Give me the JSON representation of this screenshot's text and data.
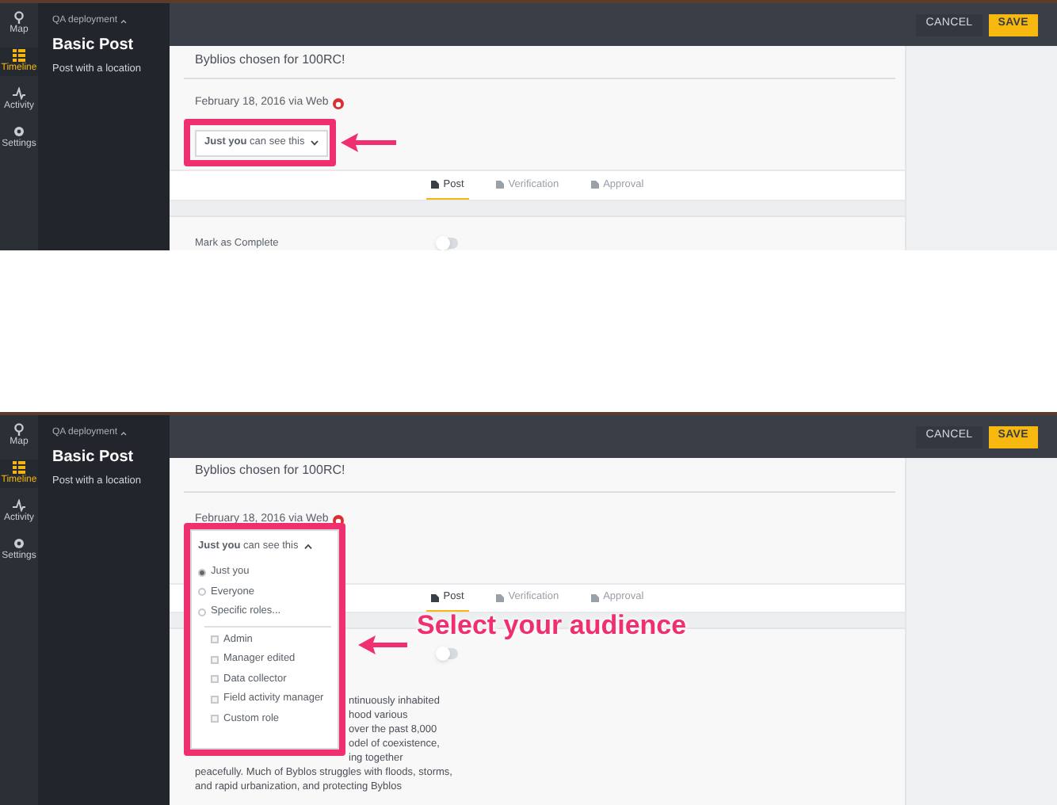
{
  "panels": [
    {
      "nav": [
        {
          "label": "Map",
          "selected": false
        },
        {
          "label": "Timeline",
          "selected": true
        },
        {
          "label": "Activity",
          "selected": false
        },
        {
          "label": "Settings",
          "selected": false
        }
      ],
      "deployment": "QA deployment",
      "title": "Basic Post",
      "subtitle": "Post with a location",
      "buttons": [
        {
          "label": "CANCEL",
          "kind": "secondary"
        },
        {
          "label": "SAVE",
          "kind": "primary"
        }
      ],
      "post_title": "Byblios chosen for 100RC!",
      "meta": "February 18, 2016 via Web",
      "visibility": {
        "label": "**Just you** can see this",
        "expanded": false
      },
      "tabs": [
        {
          "label": "Post",
          "selected": true
        },
        {
          "label": "Verification",
          "selected": false
        },
        {
          "label": "Approval",
          "selected": false
        }
      ],
      "toggle": {
        "label": "Mark as Complete",
        "on": false
      }
    },
    {
      "nav": [
        {
          "label": "Map",
          "selected": false
        },
        {
          "label": "Timeline",
          "selected": true
        },
        {
          "label": "Activity",
          "selected": false
        },
        {
          "label": "Settings",
          "selected": false
        }
      ],
      "deployment": "QA deployment",
      "title": "Basic Post",
      "subtitle": "Post with a location",
      "buttons": [
        {
          "label": "CANCEL",
          "kind": "secondary"
        },
        {
          "label": "SAVE",
          "kind": "primary"
        }
      ],
      "post_title": "Byblios chosen for 100RC!",
      "meta": "February 18, 2016 via Web",
      "visibility": {
        "label": "**Just you** can see this",
        "expanded": true,
        "options": [
          {
            "kind": "radio",
            "label": "Just you",
            "selected": true
          },
          {
            "kind": "radio",
            "label": "Everyone",
            "selected": false
          },
          {
            "kind": "radio",
            "label": "Specific roles...",
            "selected": false
          },
          {
            "kind": "checkbox",
            "label": "Admin",
            "checked": false
          },
          {
            "kind": "checkbox",
            "label": "Manager edited",
            "checked": false
          },
          {
            "kind": "checkbox",
            "label": "Data collector",
            "checked": false
          },
          {
            "kind": "checkbox",
            "label": "Field activity manager",
            "checked": false
          },
          {
            "kind": "checkbox",
            "label": "Custom role",
            "checked": false
          }
        ]
      },
      "tabs": [
        {
          "label": "Post",
          "selected": true
        },
        {
          "label": "Verification",
          "selected": false
        },
        {
          "label": "Approval",
          "selected": false
        }
      ],
      "annotation": "Select your audience",
      "toggle": {
        "on": false
      },
      "description_beside_menu": [
        "ntinuously inhabited",
        "hood various",
        "over the past 8,000",
        "odel of coexistence,",
        "ing together"
      ],
      "description": [
        "peacefully. Much of Byblos struggles with floods, storms,",
        "and rapid urbanization, and protecting Byblos"
      ]
    }
  ]
}
